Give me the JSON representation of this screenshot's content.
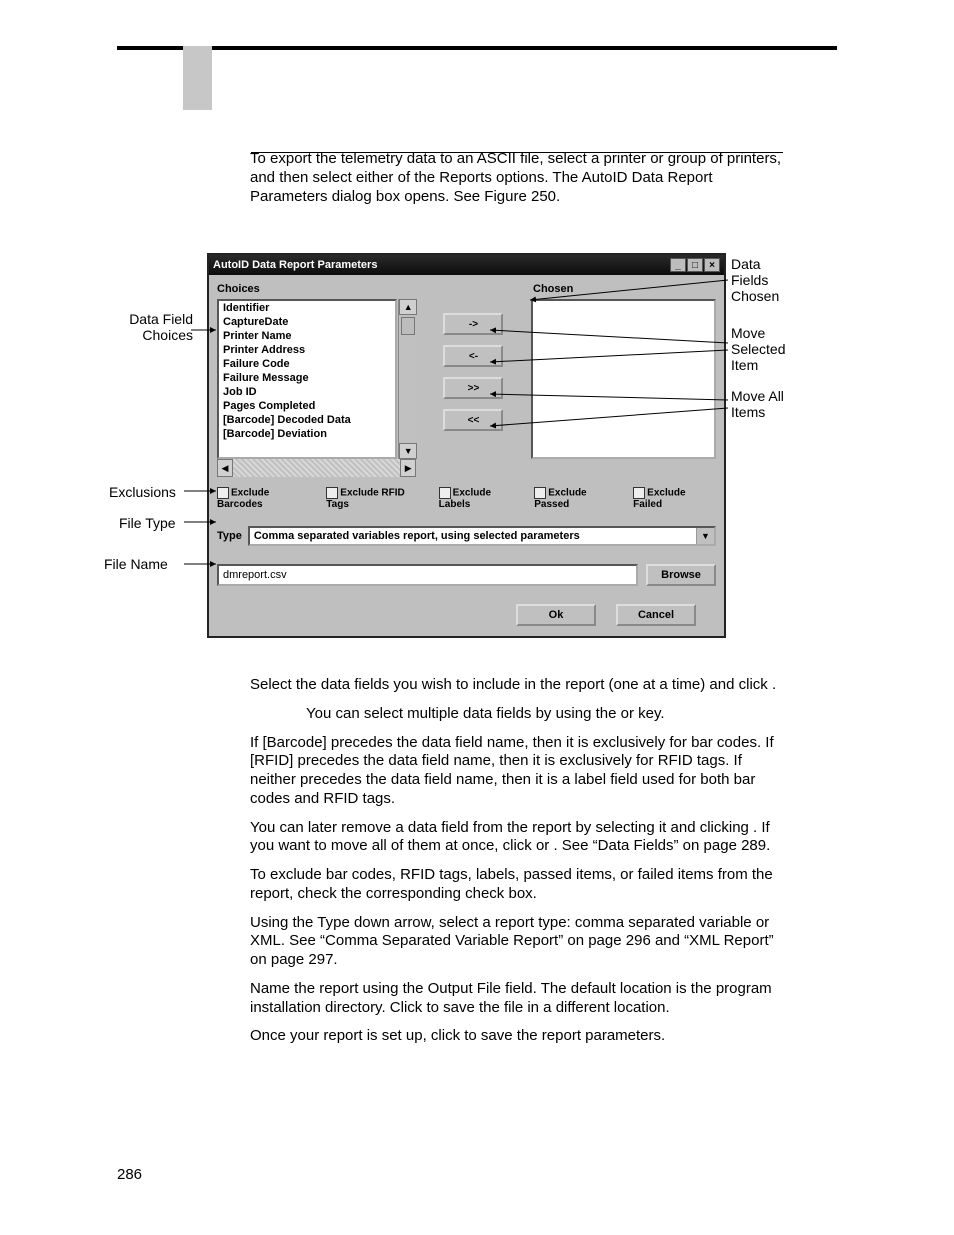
{
  "intro": "To export the telemetry data to an ASCII file, select a printer or group of printers, and then select either of the Reports options. The AutoID Data Report Parameters dialog box opens. See Figure 250.",
  "dialog": {
    "title": "AutoID Data Report Parameters",
    "choicesLabel": "Choices",
    "chosenLabel": "Chosen",
    "items": {
      "i0": "Identifier",
      "i1": "CaptureDate",
      "i2": "Printer Name",
      "i3": "Printer Address",
      "i4": "Failure Code",
      "i5": "Failure Message",
      "i6": "Job ID",
      "i7": "Pages Completed",
      "i8": "[Barcode] Decoded Data",
      "i9": "[Barcode] Deviation"
    },
    "moveRight": "->",
    "moveLeft": "<-",
    "moveAllRight": ">>",
    "moveAllLeft": "<<",
    "excl": {
      "barcodes": "Exclude Barcodes",
      "rfid": "Exclude RFID Tags",
      "labels": "Exclude Labels",
      "passed": "Exclude Passed",
      "failed": "Exclude Failed"
    },
    "typeLabel": "Type",
    "typeValue": "Comma separated variables report, using selected parameters",
    "filename": "dmreport.csv",
    "browse": "Browse",
    "ok": "Ok",
    "cancel": "Cancel"
  },
  "callouts": {
    "dataFieldChoices": "Data Field Choices",
    "exclusions": "Exclusions",
    "fileType": "File Type",
    "fileName": "File Name",
    "dataFieldsChosen": "Data Fields Chosen",
    "moveSelected": "Move Selected Item",
    "moveAll": "Move All Items"
  },
  "after": {
    "p1": "Select the data fields you wish to include in the report (one at a time) and click      .",
    "note": "You can select multiple data fields by using the          or          key.",
    "p2": "If [Barcode] precedes the data field name, then it is exclusively for bar codes. If [RFID] precedes the data field name, then it is exclusively for RFID tags. If neither precedes the data field name, then it is a label field used for both bar codes and RFID tags.",
    "p3": "You can later remove a data field from the report by selecting it and clicking      . If you want to move all of them at once, click        or      . See “Data Fields” on page 289.",
    "p4": "To exclude bar codes, RFID tags, labels, passed items, or failed items from the report, check the corresponding check box.",
    "p5": "Using the Type down arrow, select a report type: comma separated variable or XML. See “Comma Separated Variable Report” on page 296 and “XML Report” on page 297.",
    "p6": "Name the report using the Output File field. The default location is the program installation directory. Click                to save the file in a different location.",
    "p7": "Once your report is set up, click         to save the report parameters."
  },
  "pageNumber": "286"
}
